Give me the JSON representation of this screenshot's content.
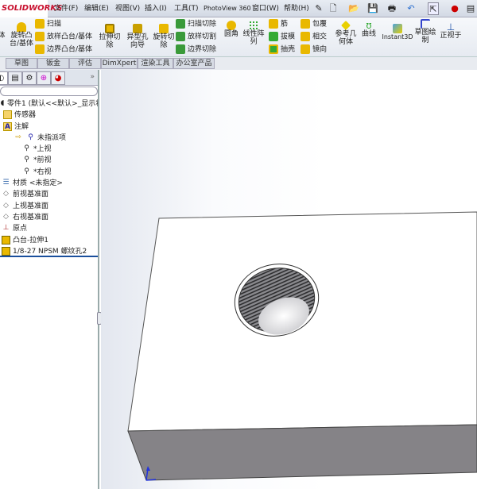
{
  "app": {
    "logo": "SOLIDWORKS"
  },
  "menubar": {
    "items": [
      "文件(F)",
      "编辑(E)",
      "视图(V)",
      "插入(I)",
      "工具(T)",
      "PhotoView 360",
      "窗口(W)",
      "帮助(H)"
    ]
  },
  "ribbon": {
    "partial_left": "体",
    "revolve_boss": "旋转凸\n台/基体",
    "sweep": "扫描",
    "loft": "放样凸台/基体",
    "boundary": "边界凸台/基体",
    "extrude_cut": "拉伸切\n除",
    "hole_wizard": "异型孔\n向导",
    "revolve_cut": "旋转切\n除",
    "sweep_cut": "扫描切除",
    "loft_cut": "放样切割",
    "boundary_cut": "边界切除",
    "fillet": "圆角",
    "linear_pattern": "线性阵\n列",
    "rib": "筋",
    "draft": "拔模",
    "shell": "抽壳",
    "wrap": "包覆",
    "intersect": "相交",
    "mirror": "镜向",
    "ref_geometry": "参考几\n何体",
    "curves": "曲线",
    "instant3d": "Instant3D",
    "sketch": "草图绘\n制",
    "normal_to": "正视于"
  },
  "tabs": [
    "草图",
    "钣金",
    "评估",
    "DimXpert",
    "渲染工具",
    "办公室产品"
  ],
  "tree": {
    "root": "零件1 (默认<<默认>_显示状态",
    "items": [
      "传感器",
      "注解",
      "未指派项",
      "*上视",
      "*前视",
      "*右视",
      "材质 <未指定>",
      "前视基准面",
      "上视基准面",
      "右视基准面",
      "原点",
      "凸台-拉伸1",
      "1/8-27 NPSM 螺纹孔2"
    ]
  },
  "colors": {
    "accent": "#c8102e",
    "face_top": "#ffffff",
    "face_front": "#858387",
    "selection": "#1a4f9c"
  }
}
